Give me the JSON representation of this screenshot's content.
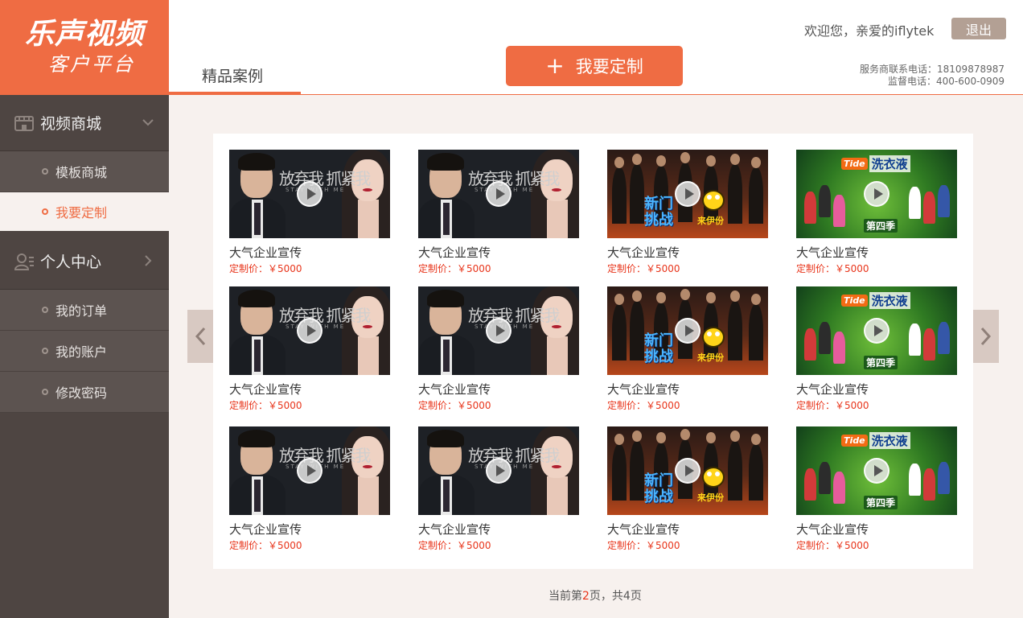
{
  "logo": {
    "title": "乐声视频",
    "subtitle": "客户平台"
  },
  "sidebar": {
    "groups": [
      {
        "label": "视频商城",
        "icon": "store-icon",
        "items": [
          "模板商城",
          "我要定制"
        ],
        "active_item": "我要定制"
      },
      {
        "label": "个人中心",
        "icon": "user-center-icon",
        "items": [
          "我的订单",
          "我的账户",
          "修改密码"
        ]
      }
    ]
  },
  "header": {
    "welcome": "欢迎您，亲爱的iflytek",
    "logout": "退出",
    "tab": "精品案例",
    "custom_button": "我要定制",
    "service_phone": "服务商联系电话：18109878987",
    "supervise_phone": "监督电话：400-600-0909"
  },
  "cards": [
    {
      "thumb": "romance",
      "title": "大气企业宣传",
      "price": "定制价：￥5000"
    },
    {
      "thumb": "romance",
      "title": "大气企业宣传",
      "price": "定制价：￥5000"
    },
    {
      "thumb": "show",
      "title": "大气企业宣传",
      "price": "定制价：￥5000"
    },
    {
      "thumb": "tide",
      "title": "大气企业宣传",
      "price": "定制价：￥5000"
    },
    {
      "thumb": "romance",
      "title": "大气企业宣传",
      "price": "定制价：￥5000"
    },
    {
      "thumb": "romance",
      "title": "大气企业宣传",
      "price": "定制价：￥5000"
    },
    {
      "thumb": "show",
      "title": "大气企业宣传",
      "price": "定制价：￥5000"
    },
    {
      "thumb": "tide",
      "title": "大气企业宣传",
      "price": "定制价：￥5000"
    },
    {
      "thumb": "romance",
      "title": "大气企业宣传",
      "price": "定制价：￥5000"
    },
    {
      "thumb": "romance",
      "title": "大气企业宣传",
      "price": "定制价：￥5000"
    },
    {
      "thumb": "show",
      "title": "大气企业宣传",
      "price": "定制价：￥5000"
    },
    {
      "thumb": "tide",
      "title": "大气企业宣传",
      "price": "定制价：￥5000"
    }
  ],
  "thumb_text": {
    "romance": {
      "caption": "放弃我 抓紧我",
      "caption_en": "STAY WITH ME"
    },
    "show": {
      "title_line1": "新门",
      "title_line2": "挑战",
      "sub": "来伊份"
    },
    "tide": {
      "brand_logo": "Tide",
      "brand": "洗衣液",
      "season": "第四季"
    }
  },
  "pager": {
    "prefix": "当前第",
    "current": "2",
    "middle": "页，共",
    "total": "4",
    "suffix": "页"
  },
  "colors": {
    "accent": "#ef6c43",
    "sidebar": "#4e4542",
    "price": "#e8341a",
    "logout": "#b3a094"
  }
}
